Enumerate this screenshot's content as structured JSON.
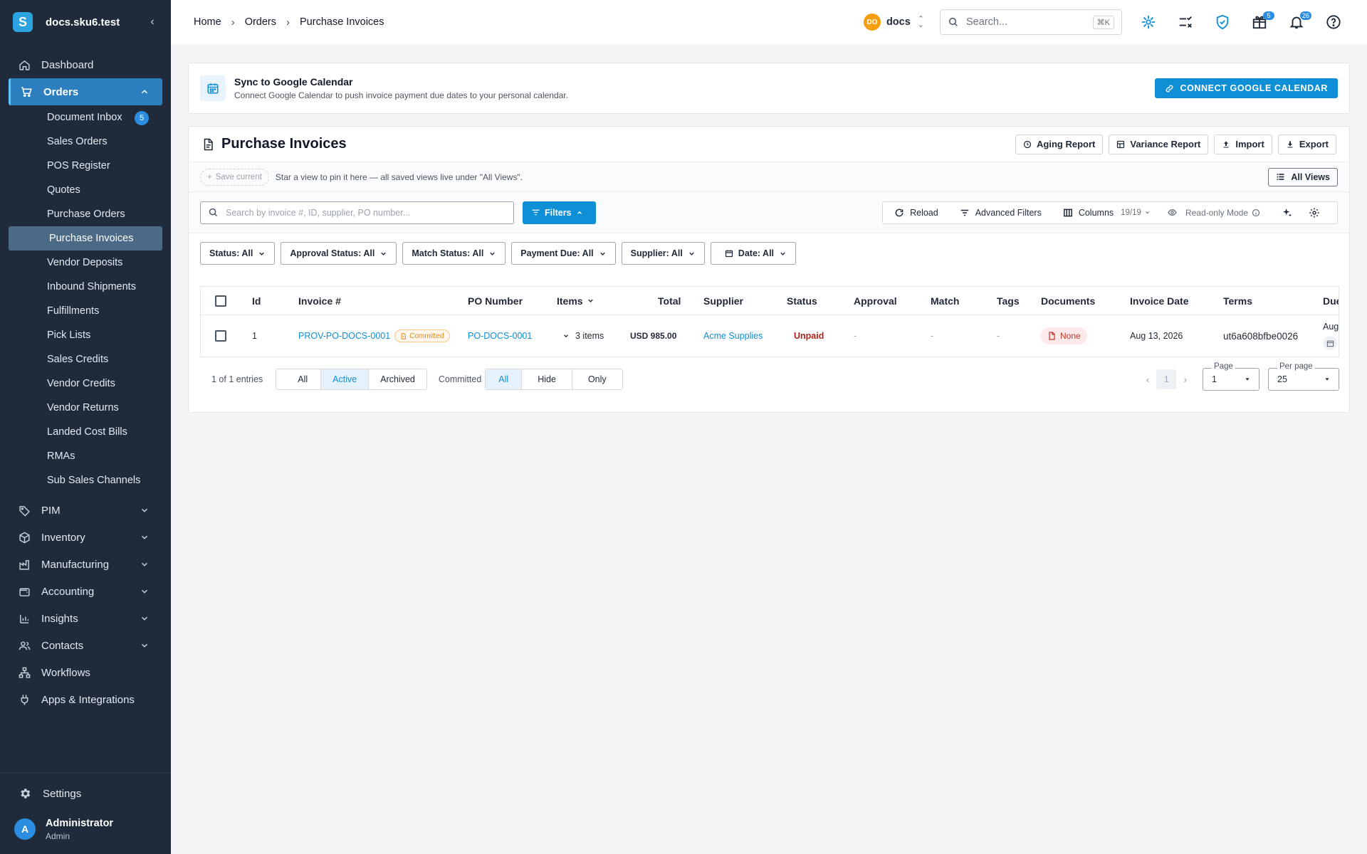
{
  "app": {
    "brand_letter": "S",
    "site_name": "docs.sku6.test"
  },
  "sidebar": {
    "items": [
      {
        "label": "Dashboard",
        "icon": "home-icon"
      },
      {
        "label": "Orders",
        "icon": "cart-icon",
        "expanded": true
      },
      {
        "label": "PIM",
        "icon": "tag-icon"
      },
      {
        "label": "Inventory",
        "icon": "box-icon"
      },
      {
        "label": "Manufacturing",
        "icon": "factory-icon"
      },
      {
        "label": "Accounting",
        "icon": "wallet-icon"
      },
      {
        "label": "Insights",
        "icon": "bar-chart-icon"
      },
      {
        "label": "Contacts",
        "icon": "people-icon"
      },
      {
        "label": "Workflows",
        "icon": "workflow-icon"
      },
      {
        "label": "Apps & Integrations",
        "icon": "plug-icon"
      }
    ],
    "orders_sub": [
      {
        "label": "Document Inbox",
        "badge": "5"
      },
      {
        "label": "Sales Orders"
      },
      {
        "label": "POS Register"
      },
      {
        "label": "Quotes"
      },
      {
        "label": "Purchase Orders"
      },
      {
        "label": "Purchase Invoices"
      },
      {
        "label": "Vendor Deposits"
      },
      {
        "label": "Inbound Shipments"
      },
      {
        "label": "Fulfillments"
      },
      {
        "label": "Pick Lists"
      },
      {
        "label": "Sales Credits"
      },
      {
        "label": "Vendor Credits"
      },
      {
        "label": "Vendor Returns"
      },
      {
        "label": "Landed Cost Bills"
      },
      {
        "label": "RMAs"
      },
      {
        "label": "Sub Sales Channels"
      }
    ],
    "settings_label": "Settings",
    "user": {
      "initial": "A",
      "name": "Administrator",
      "role": "Admin"
    }
  },
  "topbar": {
    "breadcrumb": [
      "Home",
      "Orders",
      "Purchase Invoices"
    ],
    "workspace": {
      "initials": "DO",
      "name": "docs"
    },
    "search_placeholder": "Search...",
    "search_shortcut": "⌘K",
    "gift_badge": "5",
    "bell_badge": "26"
  },
  "gcal": {
    "title": "Sync to Google Calendar",
    "description": "Connect Google Calendar to push invoice payment due dates to your personal calendar.",
    "button": "CONNECT GOOGLE CALENDAR"
  },
  "page": {
    "title": "Purchase Invoices",
    "actions": [
      "Aging Report",
      "Variance Report",
      "Import",
      "Export"
    ],
    "save_current": "Save current",
    "views_hint": "Star a view to pin it here — all saved views live under \"All Views\".",
    "all_views": "All Views",
    "search_placeholder": "Search by invoice #, ID, supplier, PO number...",
    "filters_label": "Filters",
    "toolbar": {
      "reload": "Reload",
      "advanced": "Advanced Filters",
      "columns": "Columns",
      "columns_count": "19/19",
      "readonly": "Read-only Mode"
    },
    "chips": [
      "Status: All",
      "Approval Status: All",
      "Match Status: All",
      "Payment Due: All",
      "Supplier: All",
      "Date: All"
    ]
  },
  "table": {
    "headers": [
      "Id",
      "Invoice #",
      "PO Number",
      "Items",
      "Total",
      "Supplier",
      "Status",
      "Approval",
      "Match",
      "Tags",
      "Documents",
      "Invoice Date",
      "Terms",
      "Due"
    ],
    "row": {
      "id": "1",
      "invoice": "PROV-PO-DOCS-0001",
      "committed": "Committed",
      "po": "PO-DOCS-0001",
      "items": "3 items",
      "total": "USD 985.00",
      "supplier": "Acme Supplies",
      "status": "Unpaid",
      "approval": "-",
      "match": "-",
      "tags": "-",
      "documents": "None",
      "invoice_date": "Aug 13, 2026",
      "terms": "ut6a608bfbe0026",
      "due": "Aug"
    }
  },
  "footer": {
    "entries": "1 of 1 entries",
    "archive_seg": [
      "All",
      "Active",
      "Archived"
    ],
    "committed_label": "Committed",
    "committed_seg": [
      "All",
      "Hide",
      "Only"
    ],
    "page_current": "1",
    "page_label": "Page",
    "page_value": "1",
    "per_page_label": "Per page",
    "per_page_value": "25"
  }
}
